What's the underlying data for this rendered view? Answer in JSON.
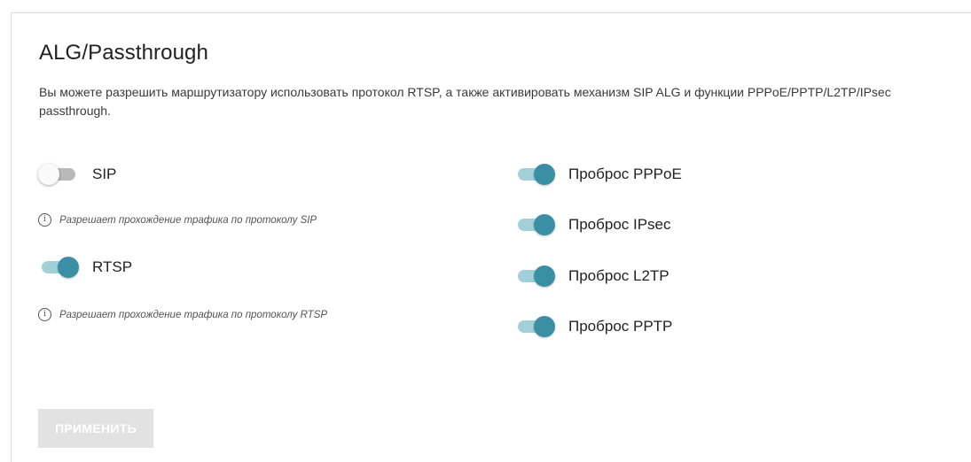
{
  "section": {
    "title": "ALG/Passthrough",
    "description": "Вы можете разрешить маршрутизатору использовать протокол RTSP, а также активировать механизм SIP ALG и функции PPPoE/PPTP/L2TP/IPsec passthrough."
  },
  "left_toggles": [
    {
      "label": "SIP",
      "enabled": false,
      "hint": "Разрешает прохождение трафика по протоколу SIP"
    },
    {
      "label": "RTSP",
      "enabled": true,
      "hint": "Разрешает прохождение трафика по протоколу RTSP"
    }
  ],
  "right_toggles": [
    {
      "label": "Проброс PPPoE",
      "enabled": true
    },
    {
      "label": "Проброс IPsec",
      "enabled": true
    },
    {
      "label": "Проброс L2TP",
      "enabled": true
    },
    {
      "label": "Проброс PPTP",
      "enabled": true
    }
  ],
  "apply_button": {
    "label": "ПРИМЕНИТЬ",
    "disabled": true
  },
  "colors": {
    "toggle_on_knob": "#3a8fa5",
    "toggle_on_track": "#a3d0d8",
    "toggle_off_track": "#b9b9b9",
    "button_disabled": "#e2e2e2"
  },
  "icons": {
    "hint": "info-icon"
  }
}
